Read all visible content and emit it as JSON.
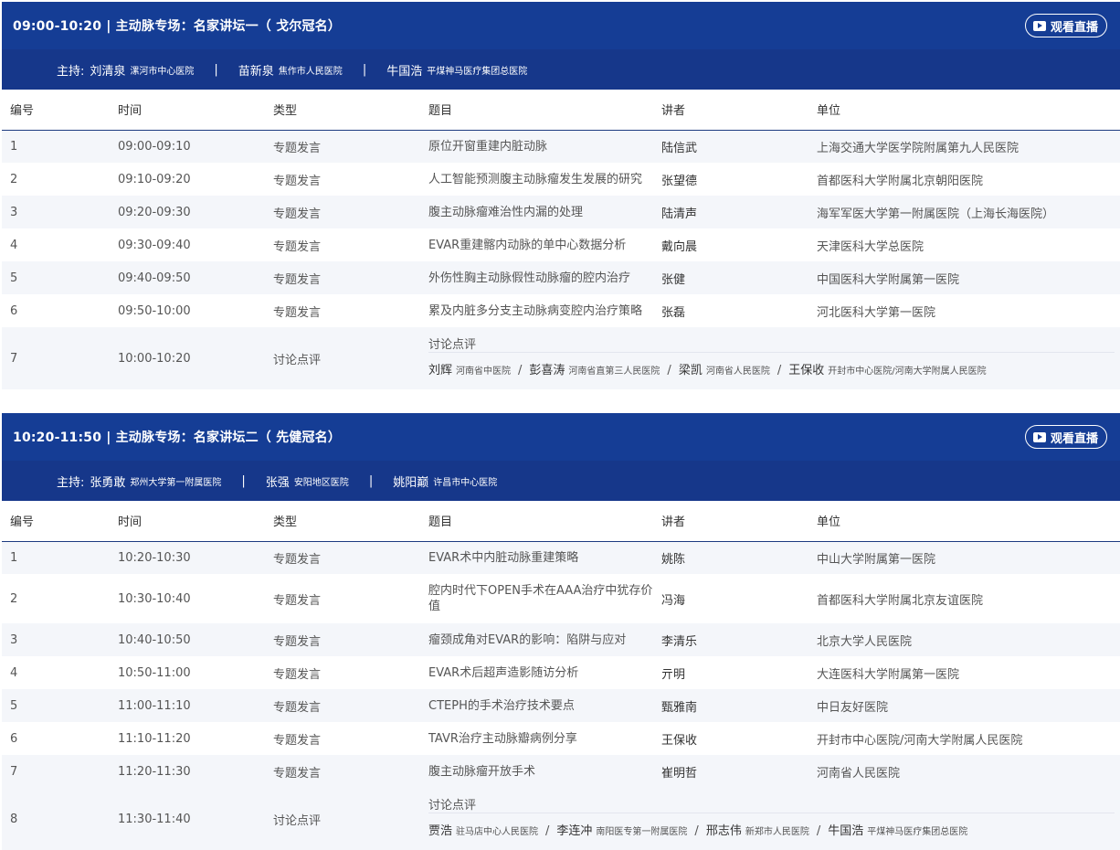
{
  "live_label": "观看直播",
  "headers": {
    "no": "编号",
    "time": "时间",
    "type": "类型",
    "topic": "题目",
    "speaker": "讲者",
    "unit": "单位"
  },
  "chair_label": "主持:",
  "sessions": [
    {
      "title": "09:00-10:20 | 主动脉专场：名家讲坛一（ 戈尔冠名）",
      "chairs": [
        {
          "name": "刘清泉",
          "inst": "漯河市中心医院"
        },
        {
          "name": "苗新泉",
          "inst": "焦作市人民医院"
        },
        {
          "name": "牛国浩",
          "inst": "平煤神马医疗集团总医院"
        }
      ],
      "rows": [
        {
          "no": "1",
          "time": "09:00-09:10",
          "type": "专题发言",
          "topic": "原位开窗重建内脏动脉",
          "speaker": "陆信武",
          "unit": "上海交通大学医学院附属第九人民医院"
        },
        {
          "no": "2",
          "time": "09:10-09:20",
          "type": "专题发言",
          "topic": "人工智能预测腹主动脉瘤发生发展的研究",
          "speaker": "张望德",
          "unit": "首都医科大学附属北京朝阳医院"
        },
        {
          "no": "3",
          "time": "09:20-09:30",
          "type": "专题发言",
          "topic": "腹主动脉瘤难治性内漏的处理",
          "speaker": "陆清声",
          "unit": "海军军医大学第一附属医院（上海长海医院）"
        },
        {
          "no": "4",
          "time": "09:30-09:40",
          "type": "专题发言",
          "topic": "EVAR重建髂内动脉的单中心数据分析",
          "speaker": "戴向晨",
          "unit": "天津医科大学总医院"
        },
        {
          "no": "5",
          "time": "09:40-09:50",
          "type": "专题发言",
          "topic": "外伤性胸主动脉假性动脉瘤的腔内治疗",
          "speaker": "张健",
          "unit": "中国医科大学附属第一医院"
        },
        {
          "no": "6",
          "time": "09:50-10:00",
          "type": "专题发言",
          "topic": "累及内脏多分支主动脉病变腔内治疗策略",
          "speaker": "张磊",
          "unit": "河北医科大学第一医院"
        }
      ],
      "discussion": {
        "no": "7",
        "time": "10:00-10:20",
        "type": "讨论点评",
        "topic": "讨论点评",
        "people": [
          {
            "name": "刘辉",
            "inst": "河南省中医院"
          },
          {
            "name": "彭喜涛",
            "inst": "河南省直第三人民医院"
          },
          {
            "name": "梁凯",
            "inst": "河南省人民医院"
          },
          {
            "name": "王保收",
            "inst": "开封市中心医院/河南大学附属人民医院"
          }
        ]
      }
    },
    {
      "title": "10:20-11:50 | 主动脉专场：名家讲坛二（ 先健冠名）",
      "chairs": [
        {
          "name": "张勇敢",
          "inst": "郑州大学第一附属医院"
        },
        {
          "name": "张强",
          "inst": "安阳地区医院"
        },
        {
          "name": "姚阳巅",
          "inst": "许昌市中心医院"
        }
      ],
      "rows": [
        {
          "no": "1",
          "time": "10:20-10:30",
          "type": "专题发言",
          "topic": "EVAR术中内脏动脉重建策略",
          "speaker": "姚陈",
          "unit": "中山大学附属第一医院"
        },
        {
          "no": "2",
          "time": "10:30-10:40",
          "type": "专题发言",
          "topic": "腔内时代下OPEN手术在AAA治疗中犹存价值",
          "speaker": "冯海",
          "unit": "首都医科大学附属北京友谊医院"
        },
        {
          "no": "3",
          "time": "10:40-10:50",
          "type": "专题发言",
          "topic": "瘤颈成角对EVAR的影响：陷阱与应对",
          "speaker": "李清乐",
          "unit": "北京大学人民医院"
        },
        {
          "no": "4",
          "time": "10:50-11:00",
          "type": "专题发言",
          "topic": "EVAR术后超声造影随访分析",
          "speaker": "亓明",
          "unit": "大连医科大学附属第一医院"
        },
        {
          "no": "5",
          "time": "11:00-11:10",
          "type": "专题发言",
          "topic": "CTEPH的手术治疗技术要点",
          "speaker": "甄雅南",
          "unit": "中日友好医院"
        },
        {
          "no": "6",
          "time": "11:10-11:20",
          "type": "专题发言",
          "topic": "TAVR治疗主动脉瓣病例分享",
          "speaker": "王保收",
          "unit": "开封市中心医院/河南大学附属人民医院"
        },
        {
          "no": "7",
          "time": "11:20-11:30",
          "type": "专题发言",
          "topic": "腹主动脉瘤开放手术",
          "speaker": "崔明哲",
          "unit": "河南省人民医院"
        }
      ],
      "discussion": {
        "no": "8",
        "time": "11:30-11:40",
        "type": "讨论点评",
        "topic": "讨论点评",
        "people": [
          {
            "name": "贾浩",
            "inst": "驻马店中心人民医院"
          },
          {
            "name": "李连冲",
            "inst": "南阳医专第一附属医院"
          },
          {
            "name": "邢志伟",
            "inst": "新郑市人民医院"
          },
          {
            "name": "牛国浩",
            "inst": "平煤神马医疗集团总医院"
          }
        ]
      }
    }
  ]
}
